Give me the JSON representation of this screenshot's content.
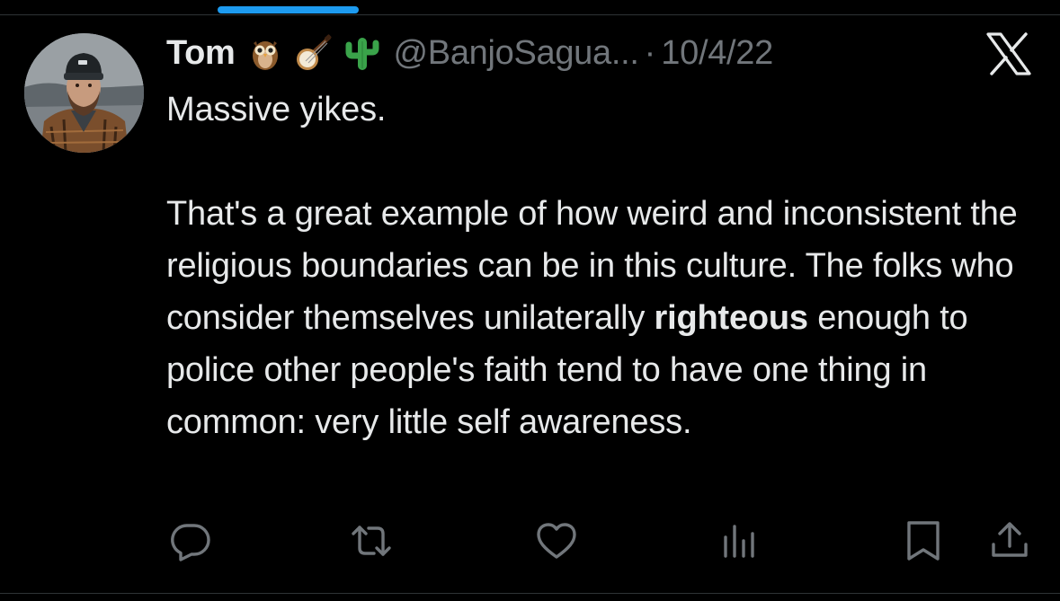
{
  "colors": {
    "background": "#000000",
    "text": "#e7e9ea",
    "secondary_text": "#71767b",
    "accent": "#1d9bf0"
  },
  "tweet": {
    "author_name": "Tom",
    "author_emojis": [
      "owl-emoji",
      "banjo-emoji",
      "cactus-emoji"
    ],
    "handle": "@BanjoSagua...",
    "separator": "·",
    "date": "10/4/22",
    "line_1": "Massive yikes.",
    "body_before_bold": "That's a great example of how weird and inconsistent the religious boundaries can be in this culture. The folks who consider themselves unilaterally ",
    "body_bold": "righteous",
    "body_after_bold": " enough to police other people's faith tend to have one thing in common: very little self awareness."
  },
  "icons": {
    "platform_logo": "x-logo-icon",
    "actions": [
      "reply-icon",
      "retweet-icon",
      "like-icon",
      "views-icon",
      "bookmark-icon",
      "share-icon"
    ]
  }
}
